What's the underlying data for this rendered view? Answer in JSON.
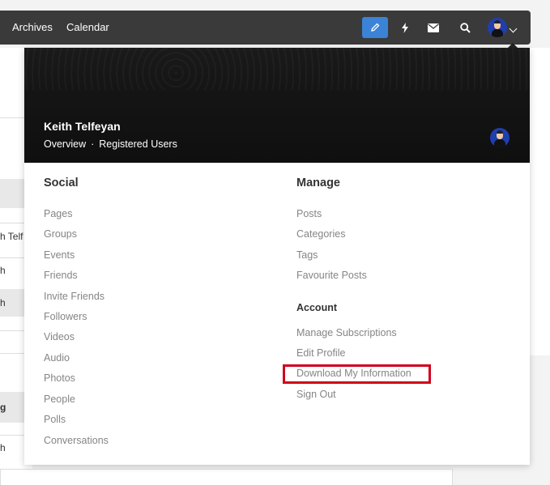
{
  "navbar": {
    "links": [
      "Archives",
      "Calendar"
    ],
    "icons": [
      "pencil-icon",
      "lightning-icon",
      "envelope-icon",
      "search-icon",
      "avatar",
      "chevron-down-icon"
    ],
    "active_color": "#3b83d6"
  },
  "background": {
    "row_fragments": [
      "h Telf",
      "h",
      "h",
      "g",
      "h"
    ]
  },
  "profile": {
    "name": "Keith Telfeyan",
    "links": [
      "Overview",
      "Registered Users"
    ],
    "separator": "·"
  },
  "social": {
    "title": "Social",
    "items": [
      "Pages",
      "Groups",
      "Events",
      "Friends",
      "Invite Friends",
      "Followers",
      "Videos",
      "Audio",
      "Photos",
      "People",
      "Polls",
      "Conversations"
    ]
  },
  "manage": {
    "title": "Manage",
    "items": [
      "Posts",
      "Categories",
      "Tags",
      "Favourite Posts"
    ]
  },
  "account": {
    "title": "Account",
    "items": [
      "Manage Subscriptions",
      "Edit Profile",
      "Download My Information",
      "Sign Out"
    ],
    "highlight_color": "#d0021b"
  }
}
